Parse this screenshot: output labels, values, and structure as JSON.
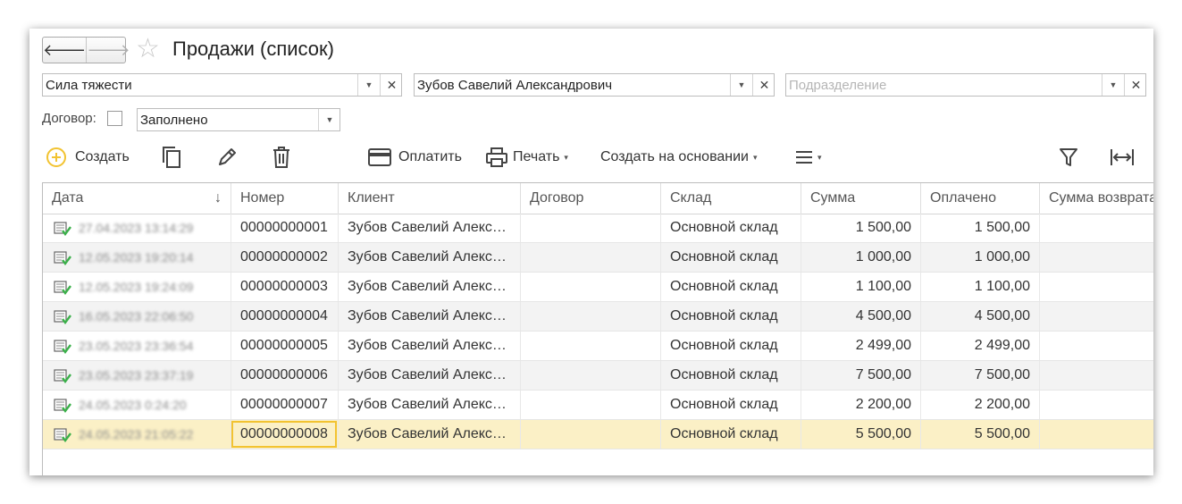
{
  "window": {
    "title": "Продажи (список)"
  },
  "nav": {
    "back": "🡐",
    "forward": "🡒"
  },
  "filters": {
    "org": {
      "value": "Сила тяжести"
    },
    "client": {
      "value": "Зубов Савелий Александрович"
    },
    "division": {
      "placeholder": "Подразделение"
    },
    "contract_label": "Договор:",
    "contract_value": "Заполнено",
    "dropdown_glyph": "▼",
    "clear_glyph": "✕"
  },
  "toolbar": {
    "create": "Создать",
    "pay": "Оплатить",
    "print": "Печать",
    "create_based": "Создать на основании",
    "caret": "▾"
  },
  "table": {
    "sort_glyph": "↓",
    "columns": [
      "Дата",
      "Номер",
      "Клиент",
      "Договор",
      "Склад",
      "Сумма",
      "Оплачено",
      "Сумма возврата"
    ],
    "rows": [
      {
        "date": "27.04.2023 13:14:29",
        "number": "00000000001",
        "client": "Зубов Савелий Александрович",
        "contract": "",
        "warehouse": "Основной склад",
        "sum": "1 500,00",
        "paid": "1 500,00",
        "refund": ""
      },
      {
        "date": "12.05.2023 19:20:14",
        "number": "00000000002",
        "client": "Зубов Савелий Александрович",
        "contract": "",
        "warehouse": "Основной склад",
        "sum": "1 000,00",
        "paid": "1 000,00",
        "refund": ""
      },
      {
        "date": "12.05.2023 19:24:09",
        "number": "00000000003",
        "client": "Зубов Савелий Александрович",
        "contract": "",
        "warehouse": "Основной склад",
        "sum": "1 100,00",
        "paid": "1 100,00",
        "refund": ""
      },
      {
        "date": "16.05.2023 22:06:50",
        "number": "00000000004",
        "client": "Зубов Савелий Александрович",
        "contract": "",
        "warehouse": "Основной склад",
        "sum": "4 500,00",
        "paid": "4 500,00",
        "refund": ""
      },
      {
        "date": "23.05.2023 23:36:54",
        "number": "00000000005",
        "client": "Зубов Савелий Александрович",
        "contract": "",
        "warehouse": "Основной склад",
        "sum": "2 499,00",
        "paid": "2 499,00",
        "refund": ""
      },
      {
        "date": "23.05.2023 23:37:19",
        "number": "00000000006",
        "client": "Зубов Савелий Александрович",
        "contract": "",
        "warehouse": "Основной склад",
        "sum": "7 500,00",
        "paid": "7 500,00",
        "refund": ""
      },
      {
        "date": "24.05.2023 0:24:20",
        "number": "00000000007",
        "client": "Зубов Савелий Александрович",
        "contract": "",
        "warehouse": "Основной склад",
        "sum": "2 200,00",
        "paid": "2 200,00",
        "refund": ""
      },
      {
        "date": "24.05.2023 21:05:22",
        "number": "00000000008",
        "client": "Зубов Савелий Александрович",
        "contract": "",
        "warehouse": "Основной склад",
        "sum": "5 500,00",
        "paid": "5 500,00",
        "refund": ""
      }
    ]
  },
  "colors": {
    "accent_yellow": "#f2c331",
    "selected_row": "#fbf0c6",
    "posted_icon_green": "#3bb04a"
  }
}
